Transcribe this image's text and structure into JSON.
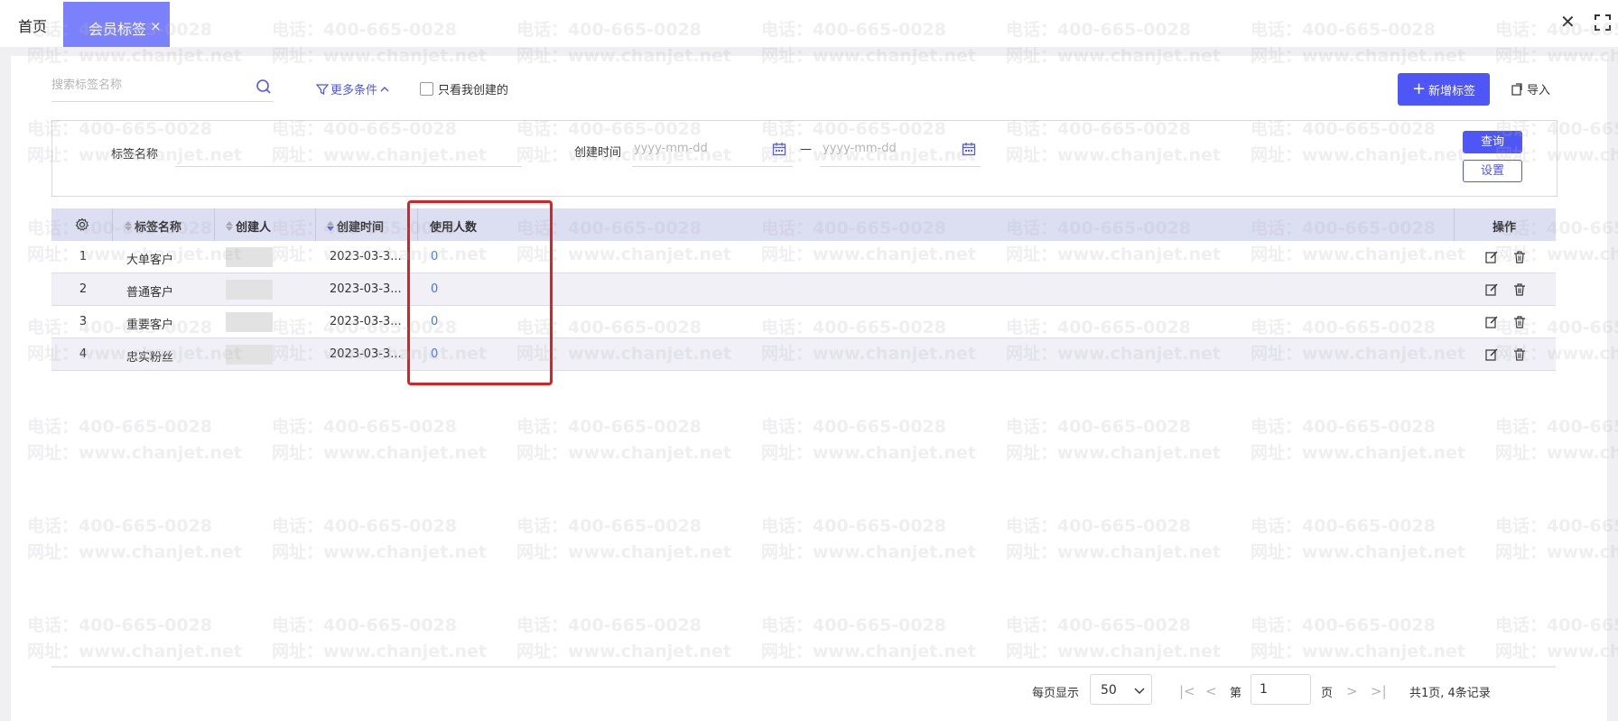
{
  "tabs": {
    "home_label": "首页",
    "active_label": "会员标签",
    "active_close": "×"
  },
  "window": {
    "close_glyph": "✕"
  },
  "toolbar": {
    "search_placeholder": "搜索标签名称",
    "more_conditions_label": "更多条件",
    "only_mine_label": "只看我创建的",
    "add_button_label": "新增标签",
    "import_button_label": "导入"
  },
  "filter": {
    "tag_name_label": "标签名称",
    "created_time_label": "创建时间",
    "start_date_placeholder": "yyyy-mm-dd",
    "end_date_placeholder": "yyyy-mm-dd",
    "range_separator": "—",
    "query_button_label": "查询",
    "settings_button_label": "设置"
  },
  "table": {
    "columns": {
      "tag_name": "标签名称",
      "creator": "创建人",
      "created_time": "创建时间",
      "user_count": "使用人数",
      "actions": "操作"
    },
    "rows": [
      {
        "index": "1",
        "tag_name": "大单客户",
        "created_time": "2023-03-3...",
        "user_count": "0"
      },
      {
        "index": "2",
        "tag_name": "普通客户",
        "created_time": "2023-03-3...",
        "user_count": "0"
      },
      {
        "index": "3",
        "tag_name": "重要客户",
        "created_time": "2023-03-3...",
        "user_count": "0"
      },
      {
        "index": "4",
        "tag_name": "忠实粉丝",
        "created_time": "2023-03-3...",
        "user_count": "0"
      }
    ]
  },
  "pagination": {
    "per_page_label": "每页显示",
    "per_page_value": "50",
    "page_prefix": "第",
    "page_value": "1",
    "page_suffix": "页",
    "summary": "共1页, 4条记录"
  },
  "watermark": {
    "phone": "电话：400-665-0028",
    "site": "网址：www.chanjet.net"
  },
  "colors": {
    "accent": "#4e56f5",
    "active_tab": "#7b81fb",
    "link_number": "#3e7bd9",
    "highlight": "#e02020"
  }
}
